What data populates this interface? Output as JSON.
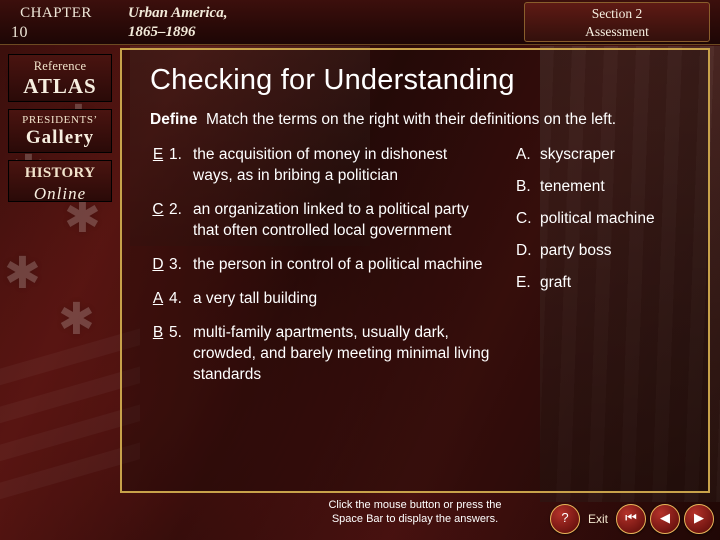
{
  "header": {
    "chapter_label": "CHAPTER",
    "chapter_number": "10",
    "unit_title_line1": "Urban America,",
    "unit_title_line2": "1865–1896",
    "section_line1": "Section 2",
    "section_line2": "Assessment"
  },
  "rail": {
    "reference_atlas_line1": "Reference",
    "reference_atlas_line2": "ATLAS",
    "presidents_gallery_line1": "PRESIDENTS’",
    "presidents_gallery_line2": "Gallery",
    "history_online_line1": "HISTORY",
    "history_online_line2": "Online"
  },
  "main": {
    "title": "Checking for Understanding",
    "instruction_label": "Define",
    "instruction_text": "Match the terms on the right with their definitions on the left.",
    "definitions": [
      {
        "answer": "E",
        "number": "1.",
        "text": "the acquisition of money in dishonest ways, as in bribing a politician"
      },
      {
        "answer": "C",
        "number": "2.",
        "text": "an organization linked to a political party that often controlled local government"
      },
      {
        "answer": "D",
        "number": "3.",
        "text": "the person in control of a political machine"
      },
      {
        "answer": "A",
        "number": "4.",
        "text": "a very tall building"
      },
      {
        "answer": "B",
        "number": "5.",
        "text": "multi-family apartments, usually dark, crowded, and barely meeting minimal living standards"
      }
    ],
    "terms": [
      {
        "letter": "A.",
        "name": "skyscraper"
      },
      {
        "letter": "B.",
        "name": "tenement"
      },
      {
        "letter": "C.",
        "name": "political machine"
      },
      {
        "letter": "D.",
        "name": "party boss"
      },
      {
        "letter": "E.",
        "name": "graft"
      }
    ]
  },
  "footer": {
    "hint_line1": "Click the mouse button or press the",
    "hint_line2": "Space Bar to display the answers.",
    "help_label": "?",
    "exit_label": "Exit",
    "first_label": "⏮",
    "prev_label": "◀",
    "next_label": "▶"
  },
  "colors": {
    "panel_border": "#c8a24a",
    "background": "#2a0d0a",
    "text": "#ffffff"
  }
}
